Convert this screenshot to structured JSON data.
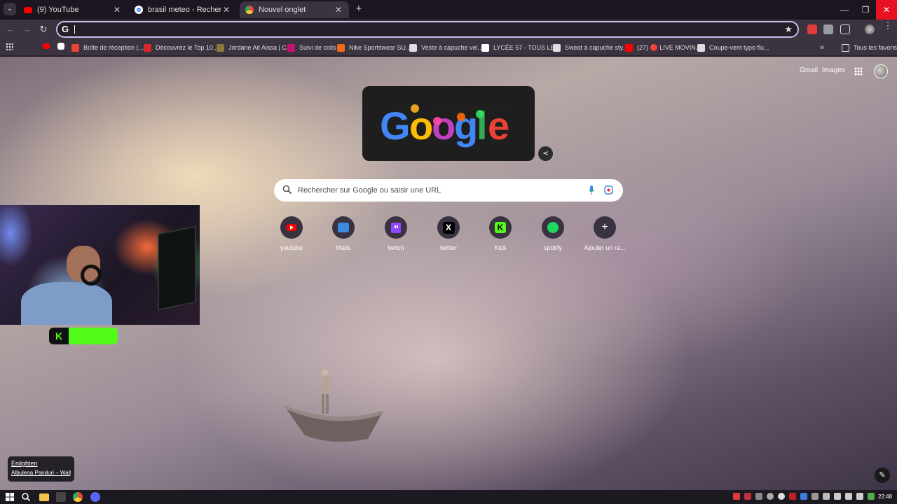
{
  "tabs": [
    {
      "title": "(9) YouTube",
      "icon": "youtube-icon"
    },
    {
      "title": "brasil meteo - Recherche Google",
      "icon": "google-icon"
    },
    {
      "title": "Nouvel onglet",
      "icon": "chrome-icon",
      "active": true
    }
  ],
  "omnibox": {
    "value": "",
    "prefix": "G"
  },
  "bookmarks": [
    {
      "label": "Boîte de réception (...",
      "color": "#ea4335"
    },
    {
      "label": "Découvrez le Top 10...",
      "color": "#d62828"
    },
    {
      "label": "Jordane Ait Aissa | C...",
      "color": "#8a7a3a"
    },
    {
      "label": "Suivi de colis",
      "color": "#c4126e"
    },
    {
      "label": "Nike Sportswear SU...",
      "color": "#f26b1d"
    },
    {
      "label": "Veste à capuche vel...",
      "color": "#dddddd"
    },
    {
      "label": "LYCÉE 57 - TOUS LE...",
      "color": "#ffffff"
    },
    {
      "label": "Sweat à capuche sty...",
      "color": "#dddddd"
    },
    {
      "label": "(27) 🔴 LIVE MOVIN...",
      "color": "#ff0000"
    },
    {
      "label": "Coupe-vent typo flu...",
      "color": "#dddddd"
    }
  ],
  "all_favorites": "Tous les favoris",
  "header": {
    "gmail": "Gmail",
    "images": "Images"
  },
  "doodle": {
    "letters": [
      "G",
      "o",
      "o",
      "g",
      "l",
      "e"
    ]
  },
  "search": {
    "placeholder": "Rechercher sur Google ou saisir une URL"
  },
  "shortcuts": [
    {
      "label": "youtube",
      "icon": "youtube-icon"
    },
    {
      "label": "Mails",
      "icon": "mail-icon"
    },
    {
      "label": "twitch",
      "icon": "twitch-icon"
    },
    {
      "label": "twitter",
      "icon": "x-icon"
    },
    {
      "label": "Kick",
      "icon": "kick-icon"
    },
    {
      "label": "spotify",
      "icon": "spotify-icon"
    },
    {
      "label": "Ajouter un ra...",
      "icon": "plus-icon"
    }
  ],
  "music": {
    "title": "Enlighten",
    "artist": "Albulena Panduri – Wallpaper"
  },
  "clock": "22:48",
  "colors": {
    "accent": "#c8bde8",
    "kick_green": "#53fc18",
    "close_red": "#e81123"
  }
}
